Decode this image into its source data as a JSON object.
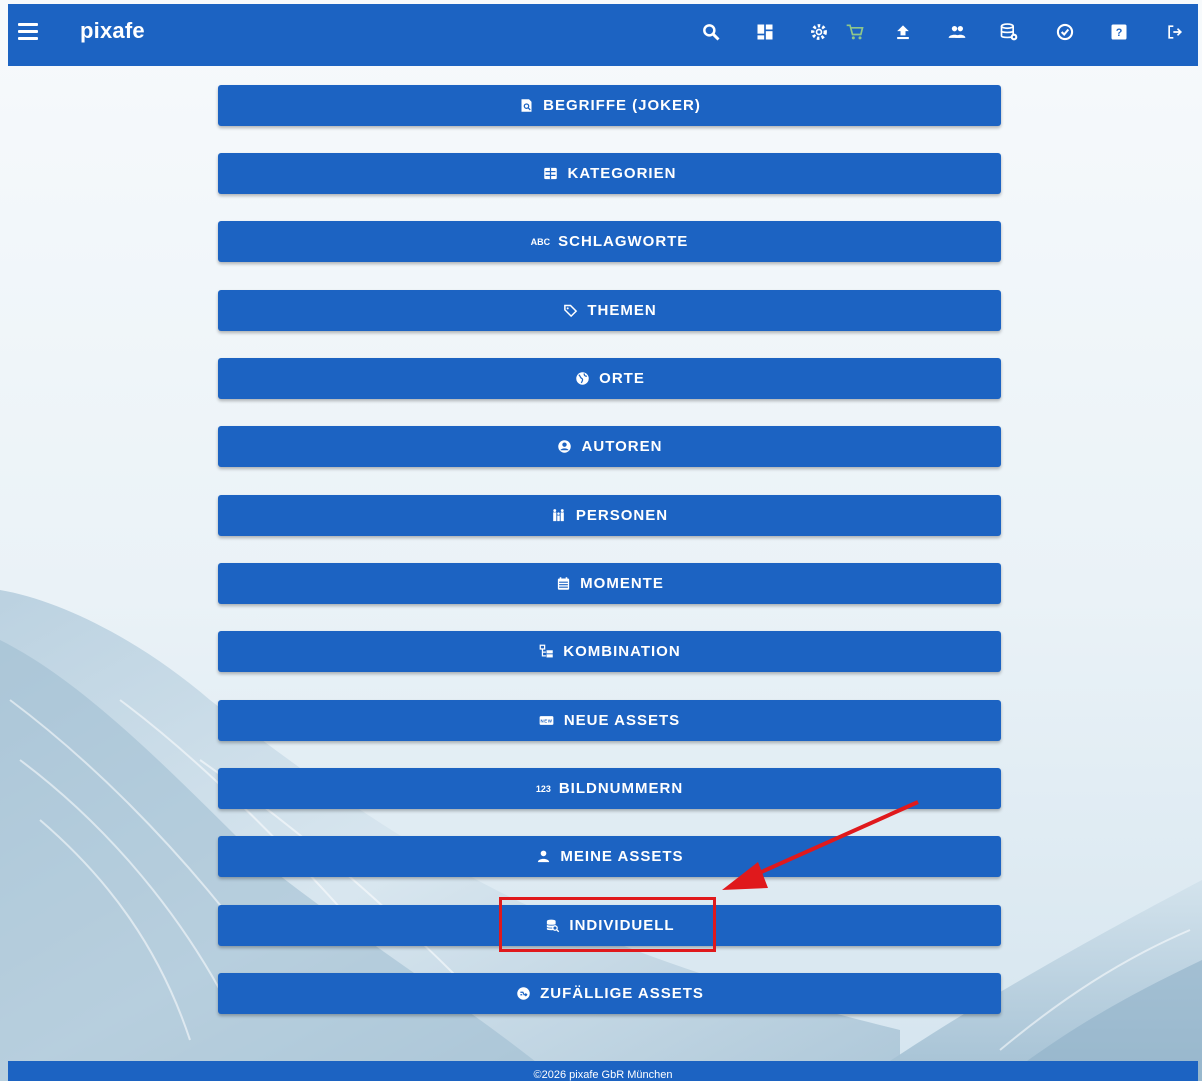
{
  "app": {
    "brand": "pixafe"
  },
  "toolbar": {
    "icons": [
      "menu-icon",
      "search-icon",
      "dashboard-icon",
      "settings-icon",
      "cart-icon",
      "upload-icon",
      "users-icon",
      "database-settings-icon",
      "check-circle-icon",
      "help-icon",
      "logout-icon"
    ]
  },
  "buttons": [
    {
      "label": "BEGRIFFE (JOKER)",
      "icon": "search-document-icon"
    },
    {
      "label": "KATEGORIEN",
      "icon": "grid-list-icon"
    },
    {
      "label": "SCHLAGWORTE",
      "icon": "abc-icon",
      "icon_text": "ABC"
    },
    {
      "label": "THEMEN",
      "icon": "tag-icon"
    },
    {
      "label": "ORTE",
      "icon": "globe-icon"
    },
    {
      "label": "AUTOREN",
      "icon": "user-circle-icon"
    },
    {
      "label": "PERSONEN",
      "icon": "people-icon"
    },
    {
      "label": "MOMENTE",
      "icon": "calendar-icon"
    },
    {
      "label": "KOMBINATION",
      "icon": "tree-icon"
    },
    {
      "label": "NEUE ASSETS",
      "icon": "new-badge-icon"
    },
    {
      "label": "BILDNUMMERN",
      "icon": "numbers-icon",
      "icon_text": "123"
    },
    {
      "label": "MEINE ASSETS",
      "icon": "person-icon"
    },
    {
      "label": "INDIVIDUELL",
      "icon": "database-search-icon"
    },
    {
      "label": "ZUFÄLLIGE ASSETS",
      "icon": "random-circle-icon"
    }
  ],
  "footer": {
    "text": "©2026 pixafe GbR München"
  },
  "colors": {
    "primary": "#1c63c2",
    "annotation": "#e0191c"
  }
}
